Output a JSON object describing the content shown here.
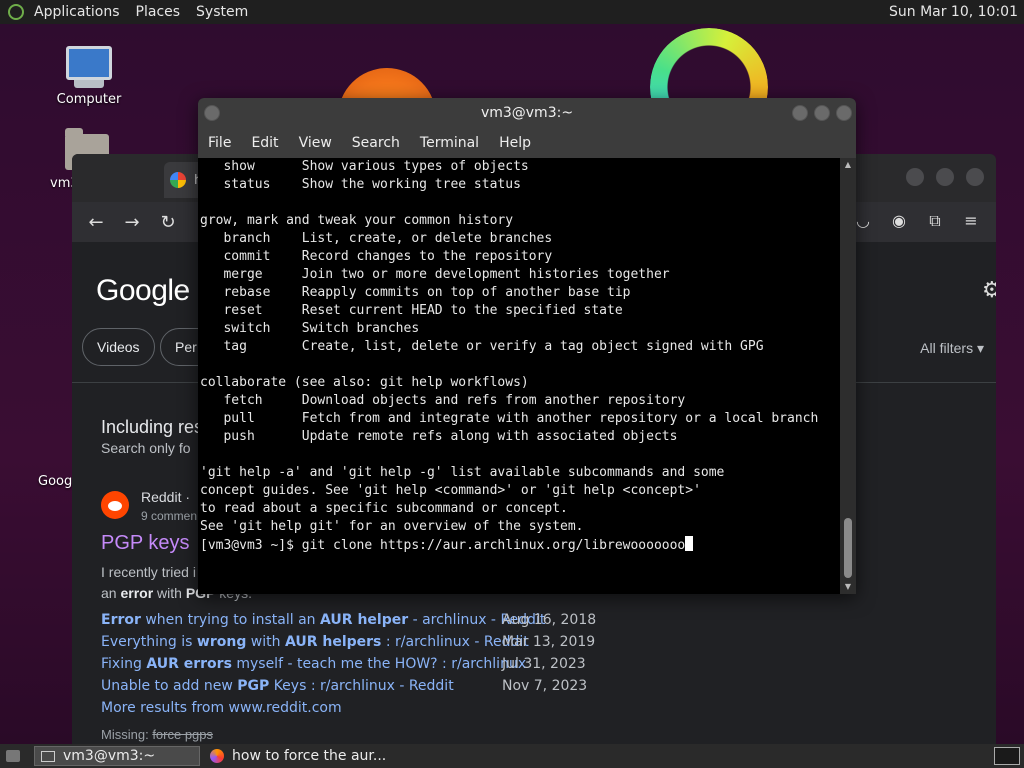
{
  "top_panel": {
    "menus": [
      "Applications",
      "Places",
      "System"
    ],
    "clock": "Sun Mar 10, 10:01"
  },
  "desktop_icons": {
    "computer": "Computer",
    "home_partial": "vm3",
    "left_partial": "Goog"
  },
  "browser": {
    "tab_title_partial": "h",
    "google_logo": "Google",
    "chips": [
      "Videos",
      "Per"
    ],
    "all_filters": "All filters",
    "including_heading": "Including res",
    "search_only": "Search only fo",
    "result": {
      "source": "Reddit",
      "source_suffix": "·",
      "comments": "9 commen",
      "title": "PGP keys",
      "snippet_line1": "I recently tried i",
      "snippet_line2_pre": "an ",
      "snippet_line2_bold": "error",
      "snippet_line2_mid": " with ",
      "snippet_line2_bold2": "PGP",
      "snippet_line2_post": " keys."
    },
    "related": [
      {
        "pre": "",
        "b1": "Error",
        "mid": " when trying to install an ",
        "b2": "AUR helper",
        "post": " - archlinux - Reddit",
        "date": "Aug 16, 2018"
      },
      {
        "pre": "Everything is ",
        "b1": "wrong",
        "mid": " with ",
        "b2": "AUR helpers",
        "post": " : r/archlinux - Reddit",
        "date": "Mar 13, 2019"
      },
      {
        "pre": "Fixing ",
        "b1": "AUR errors",
        "mid": " myself - teach me the HOW? : r/archlinux",
        "b2": "",
        "post": "",
        "date": "Jul 31, 2023"
      },
      {
        "pre": "Unable to add new ",
        "b1": "PGP",
        "mid": " Keys : r/archlinux - Reddit",
        "b2": "",
        "post": "",
        "date": "Nov 7, 2023"
      }
    ],
    "more_results": "More results from www.reddit.com",
    "missing_label": "Missing:",
    "missing_terms": "force pgps"
  },
  "terminal": {
    "title": "vm3@vm3:~",
    "menus": [
      "File",
      "Edit",
      "View",
      "Search",
      "Terminal",
      "Help"
    ],
    "lines": [
      "   show      Show various types of objects",
      "   status    Show the working tree status",
      "",
      "grow, mark and tweak your common history",
      "   branch    List, create, or delete branches",
      "   commit    Record changes to the repository",
      "   merge     Join two or more development histories together",
      "   rebase    Reapply commits on top of another base tip",
      "   reset     Reset current HEAD to the specified state",
      "   switch    Switch branches",
      "   tag       Create, list, delete or verify a tag object signed with GPG",
      "",
      "collaborate (see also: git help workflows)",
      "   fetch     Download objects and refs from another repository",
      "   pull      Fetch from and integrate with another repository or a local branch",
      "   push      Update remote refs along with associated objects",
      "",
      "'git help -a' and 'git help -g' list available subcommands and some",
      "concept guides. See 'git help <command>' or 'git help <concept>'",
      "to read about a specific subcommand or concept.",
      "See 'git help git' for an overview of the system."
    ],
    "prompt": "[vm3@vm3 ~]$ git clone https://aur.archlinux.org/librewooooooo"
  },
  "taskbar": {
    "terminal_task": "vm3@vm3:~",
    "browser_task": "how to force the aur..."
  }
}
